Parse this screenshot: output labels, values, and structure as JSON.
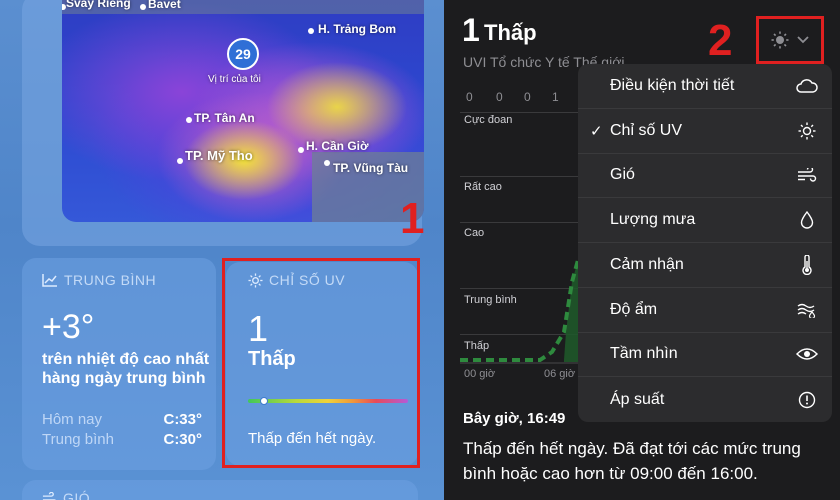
{
  "map": {
    "places": [
      "Svay Rieng",
      "Bavet",
      "H. Trảng Bom",
      "TP. Tân An",
      "TP. Mỹ Tho",
      "H. Cần Giờ",
      "TP. Vũng Tàu"
    ],
    "location_value": "29",
    "location_caption": "Vị trí của tôi"
  },
  "annotations": {
    "one": "1",
    "two": "2"
  },
  "average_tile": {
    "header": "TRUNG BÌNH",
    "value": "+3°",
    "description": "trên nhiệt độ cao nhất hàng ngày trung bình",
    "rows": [
      {
        "key": "Hôm nay",
        "value": "C:33°"
      },
      {
        "key": "Trung bình",
        "value": "C:30°"
      }
    ]
  },
  "uv_tile": {
    "header": "CHỈ SỐ UV",
    "value": "1",
    "level": "Thấp",
    "summary": "Thấp đến hết ngày.",
    "bar_position": 0.1
  },
  "wind_tile": {
    "header": "GIÓ"
  },
  "detail": {
    "value": "1",
    "level": "Thấp",
    "subtitle": "UVI Tổ chức Y tế Thế giới",
    "top_ticks": [
      "0",
      "0",
      "0",
      "1"
    ],
    "levels": [
      "Cực đoan",
      "Rất cao",
      "Cao",
      "Trung bình",
      "Thấp"
    ],
    "x_labels": [
      "00 giờ",
      "06 giờ"
    ],
    "now_time": "Bây giờ, 16:49",
    "now_description": "Thấp đến hết ngày. Đã đạt tới các mức trung bình hoặc cao hơn từ 09:00 đến 16:00."
  },
  "menu": {
    "items": [
      {
        "label": "Điều kiện thời tiết",
        "icon": "cloud-icon",
        "checked": false
      },
      {
        "label": "Chỉ số UV",
        "icon": "sun-icon",
        "checked": true
      },
      {
        "label": "Gió",
        "icon": "wind-icon",
        "checked": false
      },
      {
        "label": "Lượng mưa",
        "icon": "drop-icon",
        "checked": false
      },
      {
        "label": "Cảm nhận",
        "icon": "thermometer-icon",
        "checked": false
      },
      {
        "label": "Độ ẩm",
        "icon": "humidity-icon",
        "checked": false
      },
      {
        "label": "Tầm nhìn",
        "icon": "eye-icon",
        "checked": false
      },
      {
        "label": "Áp suất",
        "icon": "gauge-icon",
        "checked": false
      }
    ],
    "check_glyph": "✓"
  },
  "colors": {
    "annotation_red": "#e02020",
    "panel_dark": "#1c1c1e",
    "menu_bg": "#2c2c2e",
    "chart_green": "#2e8a3e"
  }
}
